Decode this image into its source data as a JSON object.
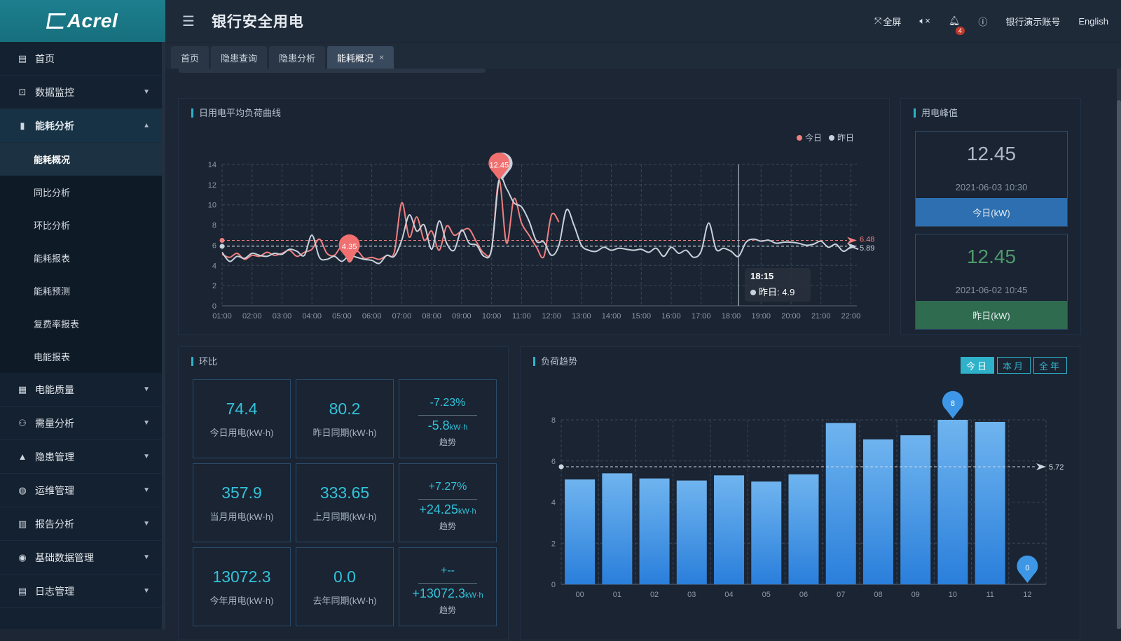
{
  "brand": {
    "logo_text": "Acrel"
  },
  "header": {
    "title": "银行安全用电",
    "fullscreen": "全屏",
    "notifications": "4",
    "account": "银行演示账号",
    "language": "English"
  },
  "sidebar": {
    "items": [
      {
        "label": "首页",
        "icon": "monitor-icon"
      },
      {
        "label": "数据监控",
        "icon": "chart-box-icon"
      },
      {
        "label": "能耗分析",
        "icon": "bar-chart-icon"
      },
      {
        "label": "电能质量",
        "icon": "calendar-icon"
      },
      {
        "label": "需量分析",
        "icon": "nodes-icon"
      },
      {
        "label": "隐患管理",
        "icon": "warning-icon"
      },
      {
        "label": "运维管理",
        "icon": "globe-icon"
      },
      {
        "label": "报告分析",
        "icon": "report-icon"
      },
      {
        "label": "基础数据管理",
        "icon": "database-icon"
      },
      {
        "label": "日志管理",
        "icon": "log-icon"
      }
    ],
    "sub_items": [
      "能耗概况",
      "同比分析",
      "环比分析",
      "能耗报表",
      "能耗预测",
      "复费率报表",
      "电能报表"
    ]
  },
  "tabs": [
    "首页",
    "隐患查询",
    "隐患分析",
    "能耗概况"
  ],
  "load_curve": {
    "title": "日用电平均负荷曲线",
    "legend_today": "今日",
    "legend_yesterday": "昨日",
    "tooltip_time": "18:15",
    "tooltip_text": "昨日: 4.9",
    "colors": {
      "today": "#f08080",
      "yesterday": "#c8d2dc"
    }
  },
  "peak": {
    "title": "用电峰值",
    "today_value": "12.45",
    "today_time": "2021-06-03 10:30",
    "today_label": "今日(kW)",
    "yesterday_value": "12.45",
    "yesterday_time": "2021-06-02 10:45",
    "yesterday_label": "昨日(kW)"
  },
  "ring": {
    "title": "环比",
    "rows": [
      {
        "cur_val": "74.4",
        "cur_label": "今日用电(kW·h)",
        "prev_val": "80.2",
        "prev_label": "昨日同期(kW·h)",
        "pct": "-7.23%",
        "diff": "-5.8",
        "unit": "kW·h",
        "trend": "趋势"
      },
      {
        "cur_val": "357.9",
        "cur_label": "当月用电(kW·h)",
        "prev_val": "333.65",
        "prev_label": "上月同期(kW·h)",
        "pct": "+7.27%",
        "diff": "+24.25",
        "unit": "kW·h",
        "trend": "趋势"
      },
      {
        "cur_val": "13072.3",
        "cur_label": "今年用电(kW·h)",
        "prev_val": "0.0",
        "prev_label": "去年同期(kW·h)",
        "pct": "+--",
        "diff": "+13072.3",
        "unit": "kW·h",
        "trend": "趋势"
      }
    ]
  },
  "trend": {
    "title": "负荷趋势",
    "btn_day": "今日",
    "btn_month": "本月",
    "btn_year": "全年"
  },
  "chart_data": [
    {
      "type": "line",
      "title": "日用电平均负荷曲线",
      "x_ticks": [
        "01:00",
        "02:00",
        "03:00",
        "04:00",
        "05:00",
        "06:00",
        "07:00",
        "08:00",
        "09:00",
        "10:00",
        "11:00",
        "12:00",
        "13:00",
        "14:00",
        "15:00",
        "16:00",
        "17:00",
        "18:00",
        "19:00",
        "20:00",
        "21:00",
        "22:00"
      ],
      "ylim": [
        0,
        14
      ],
      "y_ticks": [
        0,
        2,
        4,
        6,
        8,
        10,
        12,
        14
      ],
      "series": [
        {
          "name": "今日",
          "color": "#f08080",
          "x": [
            1.0,
            1.25,
            1.5,
            1.75,
            2.0,
            2.25,
            2.5,
            2.75,
            3.0,
            3.25,
            3.5,
            3.75,
            4.0,
            4.25,
            4.5,
            4.75,
            5.0,
            5.25,
            5.5,
            5.75,
            6.0,
            6.25,
            6.5,
            6.75,
            7.0,
            7.25,
            7.5,
            7.75,
            8.0,
            8.25,
            8.5,
            8.75,
            9.0,
            9.25,
            9.5,
            9.75,
            10.0,
            10.25,
            10.5,
            10.75,
            11.0,
            11.25,
            11.5,
            11.75,
            12.0,
            12.25
          ],
          "values": [
            5.1,
            4.8,
            5.2,
            4.6,
            5.0,
            4.9,
            5.3,
            5.0,
            5.2,
            5.5,
            4.9,
            5.3,
            5.6,
            6.6,
            5.2,
            5.0,
            5.8,
            4.35,
            5.4,
            4.7,
            4.8,
            4.6,
            5.0,
            5.3,
            10.2,
            6.8,
            8.8,
            6.5,
            7.4,
            5.5,
            7.9,
            7.0,
            7.4,
            7.6,
            6.3,
            5.2,
            5.6,
            12.45,
            6.2,
            10.6,
            8.2,
            7.0,
            5.8,
            4.9,
            9.0,
            8.3
          ],
          "mean": 6.48
        },
        {
          "name": "昨日",
          "color": "#c8d2dc",
          "x": [
            1.0,
            1.25,
            1.5,
            1.75,
            2.0,
            2.25,
            2.5,
            2.75,
            3.0,
            3.25,
            3.5,
            3.75,
            4.0,
            4.25,
            4.5,
            4.75,
            5.0,
            5.25,
            5.5,
            5.75,
            6.0,
            6.25,
            6.5,
            6.75,
            7.0,
            7.25,
            7.5,
            7.75,
            8.0,
            8.25,
            8.5,
            8.75,
            9.0,
            9.25,
            9.5,
            9.75,
            10.0,
            10.25,
            10.5,
            10.75,
            11.0,
            11.25,
            11.5,
            11.75,
            12.0,
            12.25,
            12.5,
            12.75,
            13.0,
            13.25,
            13.5,
            13.75,
            14.0,
            14.25,
            14.5,
            14.75,
            15.0,
            15.25,
            15.5,
            15.75,
            16.0,
            16.25,
            16.5,
            16.75,
            17.0,
            17.25,
            17.5,
            17.75,
            18.0,
            18.25,
            18.5,
            18.75,
            19.0,
            19.25,
            19.5,
            19.75,
            20.0,
            20.25,
            20.5,
            20.75,
            21.0,
            21.25,
            21.5,
            21.75,
            22.0,
            22.25
          ],
          "values": [
            5.3,
            4.4,
            4.9,
            4.7,
            5.2,
            5.0,
            4.9,
            5.2,
            5.1,
            5.6,
            5.4,
            5.0,
            7.0,
            4.8,
            4.6,
            4.9,
            4.4,
            5.0,
            4.8,
            4.6,
            4.5,
            4.2,
            5.0,
            4.9,
            6.5,
            9.0,
            7.4,
            8.0,
            5.6,
            8.4,
            6.2,
            5.5,
            7.5,
            6.2,
            6.0,
            4.9,
            5.6,
            12.45,
            11.6,
            10.2,
            9.8,
            8.4,
            6.4,
            6.3,
            5.0,
            6.0,
            9.5,
            8.0,
            6.0,
            5.5,
            5.4,
            5.8,
            5.5,
            5.7,
            5.6,
            5.5,
            5.6,
            5.3,
            5.7,
            4.9,
            5.8,
            5.2,
            5.5,
            4.8,
            5.4,
            8.2,
            5.6,
            5.7,
            5.4,
            4.9,
            6.3,
            6.6,
            6.4,
            6.5,
            6.2,
            6.3,
            6.3,
            6.2,
            6.0,
            6.1,
            6.4,
            5.8,
            6.1,
            5.4,
            5.8,
            5.6
          ],
          "mean": 5.89
        }
      ],
      "markers": [
        {
          "series": "今日",
          "label": "12.45",
          "x": 10.25,
          "y": 12.45
        },
        {
          "series": "今日",
          "label": "4.35",
          "x": 5.25,
          "y": 4.35
        }
      ],
      "legend": "top-right",
      "grid": true
    },
    {
      "type": "bar",
      "title": "负荷趋势",
      "categories": [
        "00",
        "01",
        "02",
        "03",
        "04",
        "05",
        "06",
        "07",
        "08",
        "09",
        "10",
        "11",
        "12"
      ],
      "values": [
        5.1,
        5.4,
        5.15,
        5.05,
        5.3,
        5.0,
        5.35,
        7.85,
        7.05,
        7.25,
        8,
        7.9,
        0
      ],
      "ylim": [
        0,
        8
      ],
      "y_ticks": [
        0,
        2,
        4,
        6,
        8
      ],
      "mean": 5.72,
      "markers": [
        {
          "label": "8",
          "category": "10",
          "value": 8
        },
        {
          "label": "0",
          "category": "12",
          "value": 0
        }
      ],
      "color": "#2f86dd",
      "grid": true
    }
  ]
}
